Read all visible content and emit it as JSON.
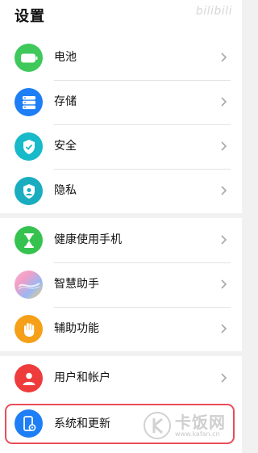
{
  "header": {
    "title": "设置",
    "watermark": "bilibili"
  },
  "groups": [
    {
      "items": [
        {
          "label": "电池",
          "icon": "battery-icon",
          "color": "#3ec95a"
        },
        {
          "label": "存储",
          "icon": "storage-icon",
          "color": "#1d7ef5"
        },
        {
          "label": "安全",
          "icon": "security-shield-icon",
          "color": "#18b9c9"
        },
        {
          "label": "隐私",
          "icon": "privacy-icon",
          "color": "#19adbf"
        }
      ]
    },
    {
      "items": [
        {
          "label": "健康使用手机",
          "icon": "hourglass-icon",
          "color": "#36c24f"
        },
        {
          "label": "智慧助手",
          "icon": "smart-assistant-icon",
          "color": "#e88fb8"
        },
        {
          "label": "辅助功能",
          "icon": "hand-icon",
          "color": "#f5a018"
        }
      ]
    },
    {
      "items": [
        {
          "label": "用户和帐户",
          "icon": "user-icon",
          "color": "#ee3b3b"
        },
        {
          "label": "系统和更新",
          "icon": "system-update-icon",
          "color": "#1d7ef5",
          "highlighted": true
        }
      ]
    }
  ],
  "watermark_bottom": {
    "brand": "卡饭网",
    "url": "www.kafan.cn"
  }
}
